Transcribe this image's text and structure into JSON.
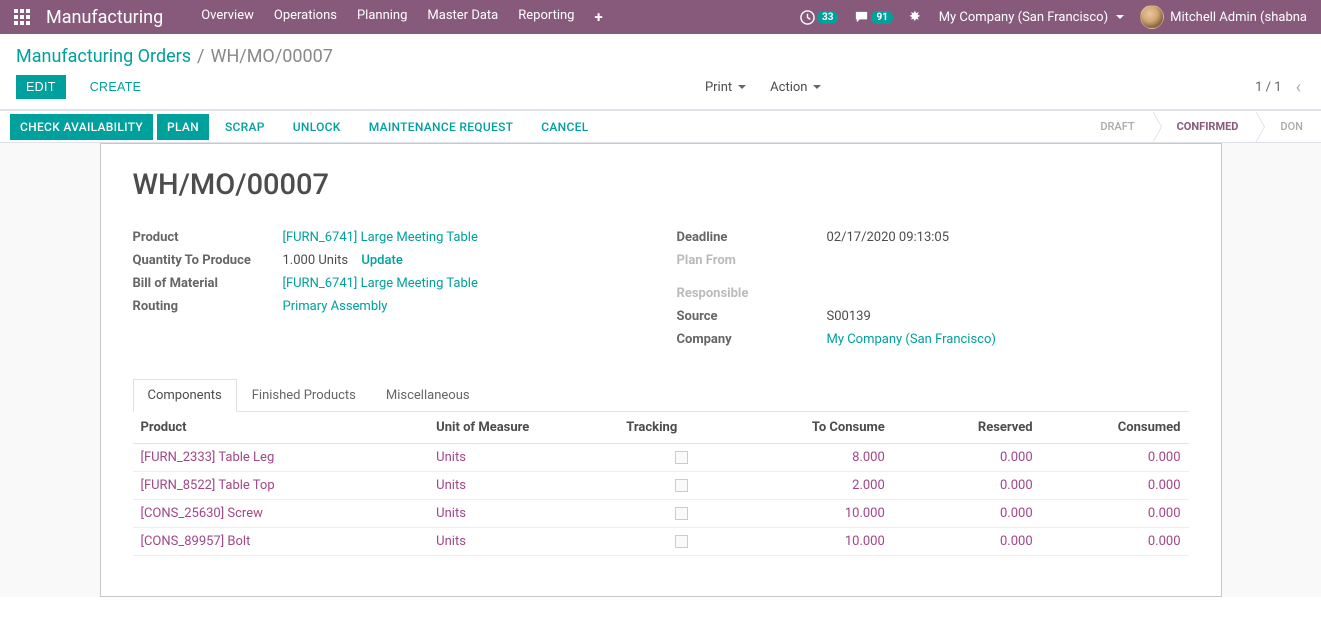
{
  "navbar": {
    "brand": "Manufacturing",
    "menu": [
      "Overview",
      "Operations",
      "Planning",
      "Master Data",
      "Reporting"
    ],
    "activity_count": "33",
    "discuss_count": "91",
    "company": "My Company (San Francisco)",
    "user": "Mitchell Admin (shabna"
  },
  "breadcrumb": {
    "parent": "Manufacturing Orders",
    "current": "WH/MO/00007"
  },
  "buttons": {
    "edit": "EDIT",
    "create": "CREATE",
    "print": "Print",
    "action": "Action"
  },
  "pager": {
    "text": "1 / 1"
  },
  "status_actions": {
    "check": "CHECK AVAILABILITY",
    "plan": "PLAN",
    "scrap": "SCRAP",
    "unlock": "UNLOCK",
    "maint": "MAINTENANCE REQUEST",
    "cancel": "CANCEL"
  },
  "stages": {
    "draft": "DRAFT",
    "confirmed": "CONFIRMED",
    "done": "DON"
  },
  "form": {
    "title": "WH/MO/00007",
    "left": {
      "product_lbl": "Product",
      "product_val": "[FURN_6741] Large Meeting Table",
      "qty_lbl": "Quantity To Produce",
      "qty_val": "1.000 Units",
      "qty_update": "Update",
      "bom_lbl": "Bill of Material",
      "bom_val": "[FURN_6741] Large Meeting Table",
      "routing_lbl": "Routing",
      "routing_val": "Primary Assembly"
    },
    "right": {
      "deadline_lbl": "Deadline",
      "deadline_val": "02/17/2020 09:13:05",
      "planfrom_lbl": "Plan From",
      "responsible_lbl": "Responsible",
      "source_lbl": "Source",
      "source_val": "S00139",
      "company_lbl": "Company",
      "company_val": "My Company (San Francisco)"
    }
  },
  "tabs": {
    "components": "Components",
    "finished": "Finished Products",
    "misc": "Miscellaneous"
  },
  "table": {
    "headers": {
      "product": "Product",
      "uom": "Unit of Measure",
      "tracking": "Tracking",
      "toconsume": "To Consume",
      "reserved": "Reserved",
      "consumed": "Consumed"
    },
    "rows": [
      {
        "product": "[FURN_2333] Table Leg",
        "uom": "Units",
        "toconsume": "8.000",
        "reserved": "0.000",
        "consumed": "0.000"
      },
      {
        "product": "[FURN_8522] Table Top",
        "uom": "Units",
        "toconsume": "2.000",
        "reserved": "0.000",
        "consumed": "0.000"
      },
      {
        "product": "[CONS_25630] Screw",
        "uom": "Units",
        "toconsume": "10.000",
        "reserved": "0.000",
        "consumed": "0.000"
      },
      {
        "product": "[CONS_89957] Bolt",
        "uom": "Units",
        "toconsume": "10.000",
        "reserved": "0.000",
        "consumed": "0.000"
      }
    ]
  }
}
